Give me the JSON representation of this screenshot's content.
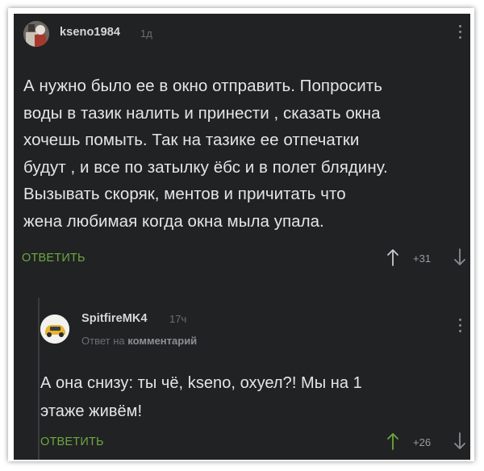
{
  "comments": [
    {
      "username": "kseno1984",
      "time": "1д",
      "text_lines": [
        "А нужно было ее в окно отправить. Попросить",
        "воды в тазик налить и принести , сказать окна",
        "хочешь помыть. Так на тазике ее отпечатки",
        "будут , и все по затылку ёбс и в полет блядину.",
        "Вызывать скоряк, ментов и причитать что",
        "жена любимая когда окна мыла упала."
      ],
      "reply_label": "ОТВЕТИТЬ",
      "score": "+31",
      "upvote_color": "#c8c9cc"
    },
    {
      "username": "SpitfireMK4",
      "time": "17ч",
      "reply_to_prefix": "Ответ на",
      "reply_to_target": "комментарий",
      "text_lines": [
        "А она снизу: ты чё, kseno, охуел?! Мы на 1",
        "этаже живём!"
      ],
      "reply_label": "ОТВЕТИТЬ",
      "score": "+26",
      "upvote_color": "#6da83e"
    }
  ],
  "icons": {
    "upvote": "arrow-up-icon",
    "downvote": "arrow-down-icon",
    "menu": "more-vertical-icon"
  },
  "colors": {
    "background": "#212224",
    "accent": "#6da83e",
    "text": "#e4e5e7",
    "muted": "#6c6e72"
  }
}
